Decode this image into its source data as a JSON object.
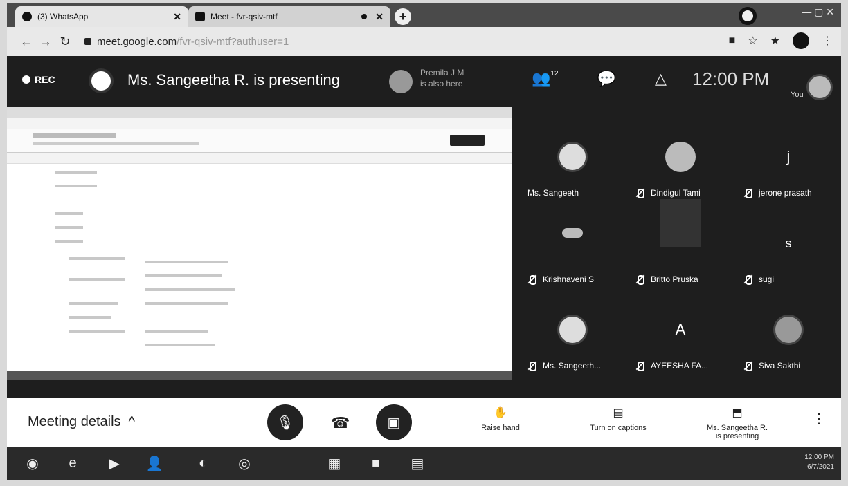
{
  "browser": {
    "tabs": [
      {
        "label": "(3) WhatsApp"
      },
      {
        "label": "Meet - fvr-qsiv-mtf"
      }
    ],
    "new_tab": "+",
    "url_main": "meet.google.com",
    "url_rest": "/fvr-qsiv-mtf?authuser=1"
  },
  "meet": {
    "rec_label": "REC",
    "presenting_title": "Ms. Sangeetha R. is presenting",
    "also_here_line1": "Premila J M",
    "also_here_line2": "is also here",
    "people_count": "12",
    "clock": "12:00 PM",
    "you_label": "You"
  },
  "participants": [
    {
      "name": "Ms. Sangeeth",
      "avatar": "photo"
    },
    {
      "name": "Dindigul Tami",
      "avatar": "photo"
    },
    {
      "name": "jerone prasath",
      "avatar": "letter",
      "letter": "j"
    },
    {
      "name": "Krishnaveni S",
      "avatar": "photo"
    },
    {
      "name": "Britto Pruska",
      "avatar": "video"
    },
    {
      "name": "sugi",
      "avatar": "letter",
      "letter": "s"
    },
    {
      "name": "Ms. Sangeeth...",
      "avatar": "photo"
    },
    {
      "name": "AYEESHA FA...",
      "avatar": "letter",
      "letter": "A"
    },
    {
      "name": "Siva Sakthi",
      "avatar": "photo"
    }
  ],
  "controls": {
    "meeting_details": "Meeting details",
    "raise_hand": "Raise hand",
    "captions": "Turn on captions",
    "presenting_line1": "Ms. Sangeetha R.",
    "presenting_line2": "is presenting"
  },
  "taskbar": {
    "time": "12:00 PM",
    "date": "6/7/2021"
  }
}
